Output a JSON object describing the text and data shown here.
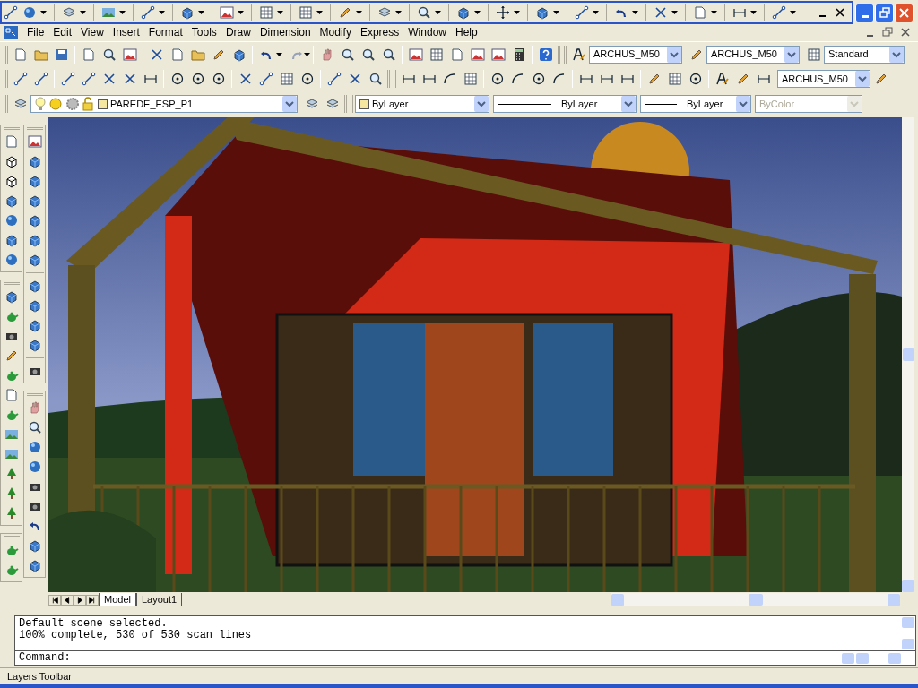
{
  "menu_bar": {
    "items": [
      "File",
      "Edit",
      "View",
      "Insert",
      "Format",
      "Tools",
      "Draw",
      "Dimension",
      "Modify",
      "Express",
      "Window",
      "Help"
    ]
  },
  "styles_toolbar": {
    "text_style": "ARCHUS_M50",
    "dim_style": "ARCHUS_M50",
    "table_style": "Standard"
  },
  "dimension_toolbar": {
    "dim_style": "ARCHUS_M50"
  },
  "layers_toolbar": {
    "layer": "PAREDE_ESP_P1"
  },
  "properties_toolbar": {
    "color_setting": "ByLayer",
    "linetype": "ByLayer",
    "lineweight": "ByLayer",
    "plot_style": {
      "value": "ByColor",
      "disabled": true
    }
  },
  "layout_tabs": [
    {
      "label": "Model",
      "selected": true
    },
    {
      "label": "Layout1",
      "selected": false
    }
  ],
  "command_history": [
    "Default scene selected.",
    "100% complete, 530 of 530 scan lines"
  ],
  "command_prompt": "Command:",
  "status_bar": "Layers Toolbar"
}
